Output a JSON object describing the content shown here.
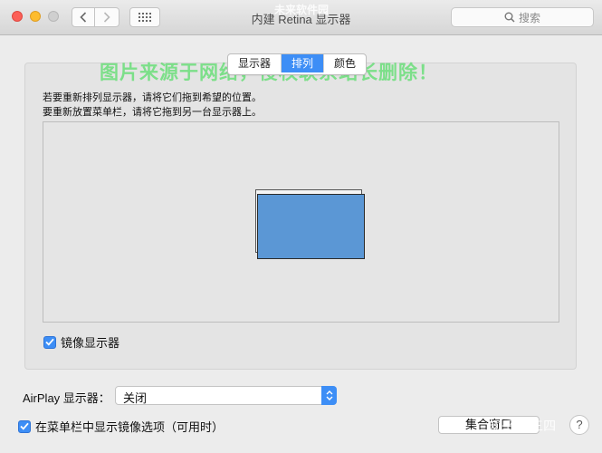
{
  "window": {
    "title": "内建 Retina 显示器",
    "search_placeholder": "搜索"
  },
  "tabs": [
    {
      "label": "显示器",
      "active": false
    },
    {
      "label": "排列",
      "active": true
    },
    {
      "label": "颜色",
      "active": false
    }
  ],
  "arrangement": {
    "instruction_line1": "若要重新排列显示器，请将它们拖到希望的位置。",
    "instruction_line2": "要重新放置菜单栏，请将它拖到另一台显示器上。",
    "mirror_label": "镜像显示器",
    "mirror_checked": true
  },
  "airplay": {
    "label": "AirPlay 显示器：",
    "selected": "关闭"
  },
  "footer": {
    "menubar_option_label": "在菜单栏中显示镜像选项（可用时）",
    "menubar_option_checked": true,
    "gather_windows_label": "集合窗口",
    "help_label": "?"
  },
  "watermarks": {
    "green": "图片来源于网络，侵权联系站长删除！",
    "top": "未来软件园",
    "bottom": "知乎 @三四"
  },
  "colors": {
    "accent": "#3d8ef6",
    "display_fill": "#5b97d5"
  }
}
